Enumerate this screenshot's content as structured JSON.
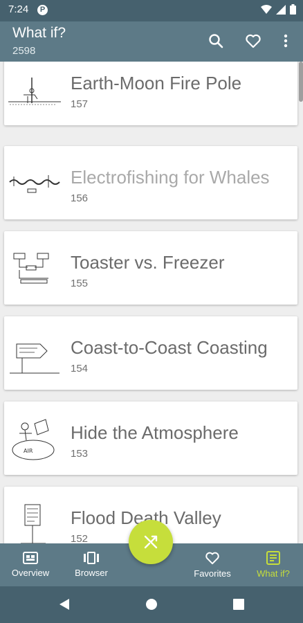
{
  "status": {
    "time": "7:24",
    "app_badge": "P"
  },
  "app_bar": {
    "title": "What if?",
    "subtitle": "2598"
  },
  "items": [
    {
      "title": "Earth-Moon Fire Pole",
      "number": "157"
    },
    {
      "title": "Electrofishing for Whales",
      "number": "156"
    },
    {
      "title": "Toaster vs. Freezer",
      "number": "155"
    },
    {
      "title": "Coast-to-Coast Coasting",
      "number": "154"
    },
    {
      "title": "Hide the Atmosphere",
      "number": "153"
    },
    {
      "title": "Flood Death Valley",
      "number": "152"
    }
  ],
  "nav": {
    "overview": "Overview",
    "browser": "Browser",
    "favorites": "Favorites",
    "whatif": "What if?"
  },
  "colors": {
    "primary": "#5d7a87",
    "dark": "#46616e",
    "accent": "#c6de3b"
  },
  "icons": [
    "search-icon",
    "heart-icon",
    "more-vert-icon",
    "shuffle-icon",
    "overview-icon",
    "browser-icon",
    "favorites-icon",
    "whatif-icon",
    "back-icon",
    "home-icon",
    "recents-icon"
  ]
}
